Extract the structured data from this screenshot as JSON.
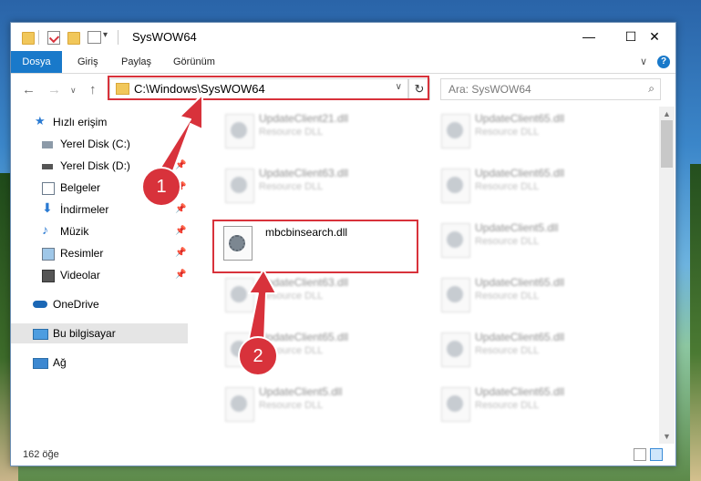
{
  "window": {
    "title": "SysWOW64",
    "minimize_glyph": "—",
    "maximize_glyph": "☐",
    "close_glyph": "✕"
  },
  "ribbon": {
    "tabs": [
      "Dosya",
      "Giriş",
      "Paylaş",
      "Görünüm"
    ],
    "collapse_glyph": "∨",
    "help_glyph": "?"
  },
  "navigation": {
    "back_glyph": "←",
    "forward_glyph": "→",
    "recent_glyph": "∨",
    "up_glyph": "↑",
    "address": "C:\\Windows\\SysWOW64",
    "address_dropdown_glyph": "∨",
    "refresh_glyph": "↻",
    "search_placeholder": "Ara: SysWOW64",
    "search_glyph": "⌕"
  },
  "sidebar": {
    "items": [
      {
        "label": "Hızlı erişim",
        "icon": "star-icon"
      },
      {
        "label": "Yerel Disk (C:)",
        "icon": "drive-icon"
      },
      {
        "label": "Yerel Disk (D:)",
        "icon": "drive-icon"
      },
      {
        "label": "Belgeler",
        "icon": "documents-icon"
      },
      {
        "label": "İndirmeler",
        "icon": "download-icon"
      },
      {
        "label": "Müzik",
        "icon": "music-icon"
      },
      {
        "label": "Resimler",
        "icon": "pictures-icon"
      },
      {
        "label": "Videolar",
        "icon": "videos-icon"
      },
      {
        "label": "OneDrive",
        "icon": "cloud-icon"
      },
      {
        "label": "Bu bilgisayar",
        "icon": "computer-icon"
      },
      {
        "label": "Ağ",
        "icon": "network-icon"
      }
    ],
    "pin_glyph": "📌"
  },
  "files": {
    "left_column": [
      {
        "name": "UpdateClient21.dll",
        "type": "Resource DLL"
      },
      {
        "name": "UpdateClient63.dll",
        "type": "Resource DLL"
      },
      {
        "name": "UpdateClient63.dll",
        "type": "Resource DLL"
      },
      {
        "name": "UpdateClient65.dll",
        "type": "Resource DLL"
      },
      {
        "name": "UpdateClient5.dll",
        "type": "Resource DLL"
      }
    ],
    "right_column": [
      {
        "name": "UpdateClient65.dll",
        "type": "Resource DLL"
      },
      {
        "name": "UpdateClient65.dll",
        "type": "Resource DLL"
      },
      {
        "name": "UpdateClient5.dll",
        "type": "Resource DLL"
      },
      {
        "name": "UpdateClient65.dll",
        "type": "Resource DLL"
      },
      {
        "name": "UpdateClient65.dll",
        "type": "Resource DLL"
      },
      {
        "name": "UpdateClient65.dll",
        "type": "Resource DLL"
      }
    ],
    "highlighted_file": "mbcbinsearch.dll"
  },
  "status": {
    "item_count": "162 öğe"
  },
  "annotations": {
    "step1": "1",
    "step2": "2",
    "color": "#d8323b"
  }
}
